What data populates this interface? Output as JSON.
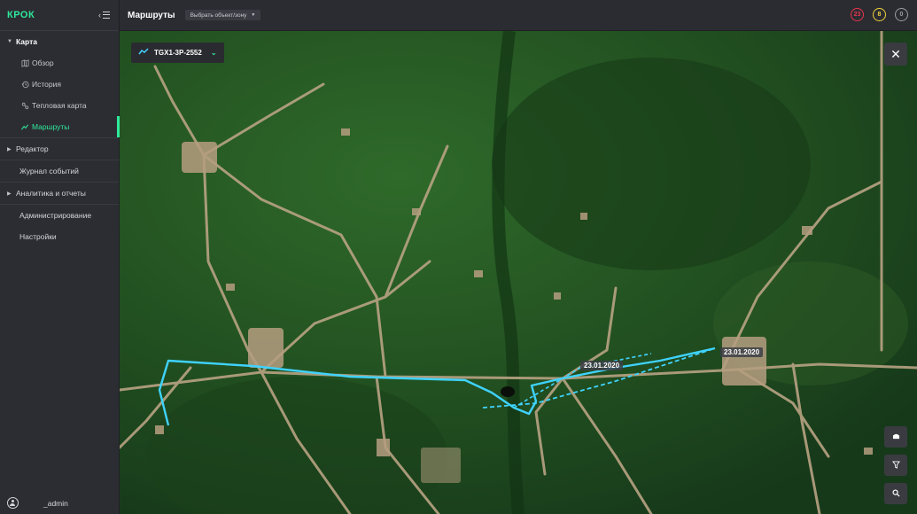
{
  "brand": "КРОК",
  "sidebar": {
    "sections": [
      {
        "label": "Карта"
      },
      {
        "label": "Редактор"
      },
      {
        "label": "Журнал событий"
      },
      {
        "label": "Аналитика и отчеты"
      },
      {
        "label": "Администрирование"
      },
      {
        "label": "Настройки"
      }
    ],
    "map_items": [
      {
        "label": "Обзор",
        "icon": "map-icon"
      },
      {
        "label": "История",
        "icon": "history-icon"
      },
      {
        "label": "Тепловая карта",
        "icon": "heatmap-icon"
      },
      {
        "label": "Маршруты",
        "icon": "route-icon",
        "active": true
      }
    ],
    "user": "_admin"
  },
  "header": {
    "title": "Маршруты",
    "zone_select": "Выбрать объект/зону",
    "badges": [
      {
        "value": "23",
        "color": "#e8344e"
      },
      {
        "value": "8",
        "color": "#f0d23c"
      },
      {
        "value": "0",
        "color": "#9a9ca3"
      }
    ]
  },
  "map": {
    "route_name": "TGX1-3P-2552",
    "dates": [
      "23.01.2020",
      "23.01.2020"
    ],
    "accent_color": "#2ee89b",
    "route_color": "#3fd3ff"
  }
}
